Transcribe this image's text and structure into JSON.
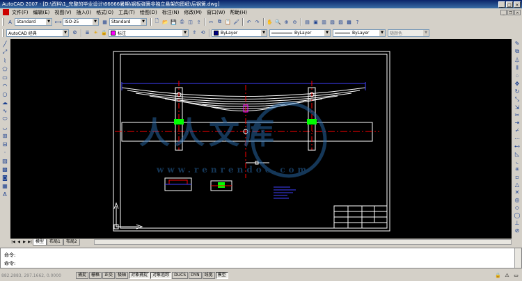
{
  "window": {
    "title": "AutoCAD 2007 - [D:\\资料\\1_完整的毕业设计\\66666暑期\\钢板弹簧非独立悬架的图纸\\后钢簧.dwg]"
  },
  "menu": [
    "文件(F)",
    "编辑(E)",
    "视图(V)",
    "插入(I)",
    "格式(O)",
    "工具(T)",
    "绘图(D)",
    "标注(N)",
    "修改(M)",
    "窗口(W)",
    "帮助(H)"
  ],
  "toolbar1": {
    "text_style": "Standard",
    "dim_style": "ISO-25",
    "table_style": "Standard"
  },
  "toolbar2": {
    "workspace": "AutoCAD 经典",
    "layer": "标注",
    "color": "ByLayer",
    "linetype": "ByLayer",
    "lineweight": "ByLayer",
    "plotstyle": "随颜色"
  },
  "watermark": {
    "line1": "人人文库",
    "line2": "www.renrendoc.com"
  },
  "tabs": [
    "模型",
    "布局1",
    "布局2"
  ],
  "command": {
    "line1": "命令:",
    "line2": "命令:"
  },
  "status": {
    "coords": "882.2883, 297.1662, 0.0000",
    "buttons": [
      "捕捉",
      "栅格",
      "正交",
      "极轴",
      "对象捕捉",
      "对象追踪",
      "DUCS",
      "DYN",
      "线宽",
      "模型"
    ]
  },
  "colors": {
    "canvas": "#000000",
    "drawing_white": "#ffffff",
    "centerline_red": "#ff0000",
    "dimension_blue": "#4040ff",
    "marker_green": "#00ff00",
    "accent_magenta": "#ff00ff"
  }
}
